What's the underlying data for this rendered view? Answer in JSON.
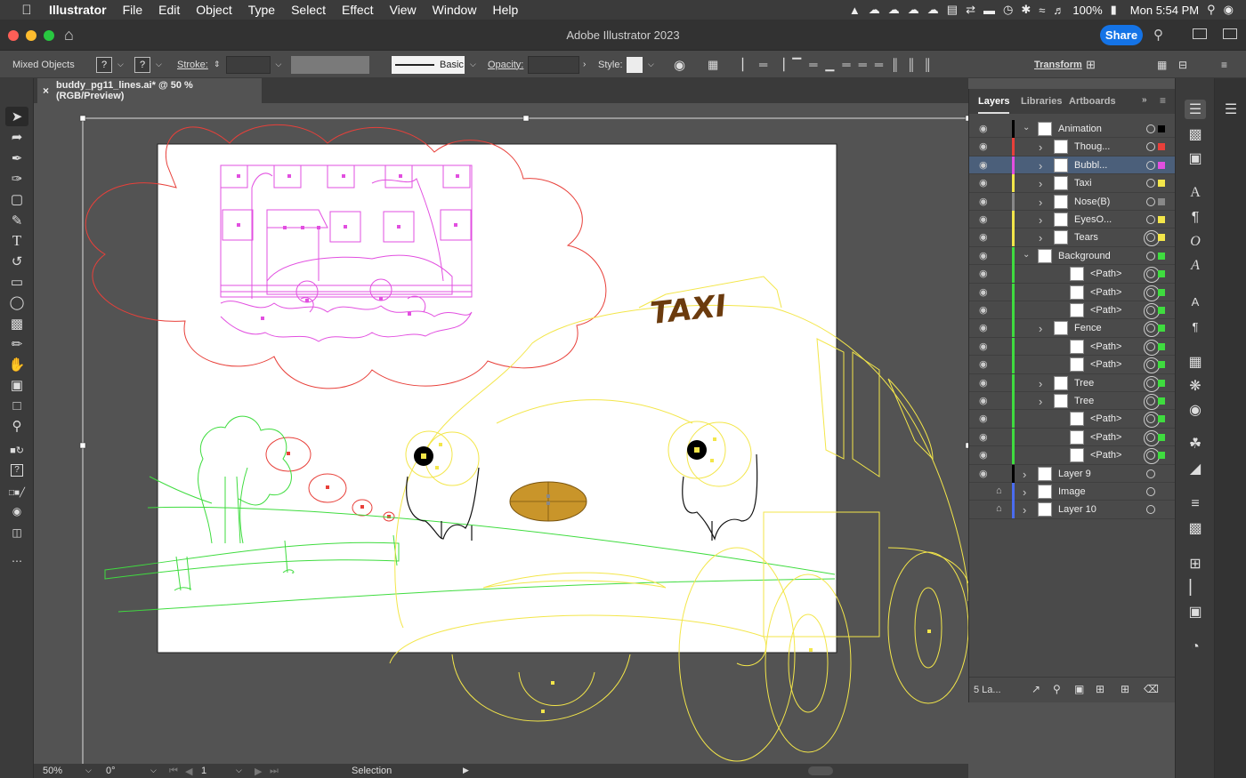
{
  "menubar": {
    "app_name": "Illustrator",
    "items": [
      "File",
      "Edit",
      "Object",
      "Type",
      "Select",
      "Effect",
      "View",
      "Window",
      "Help"
    ],
    "battery": "100%",
    "clock": "Mon 5:54 PM"
  },
  "titlebar": {
    "title": "Adobe Illustrator 2023",
    "share_label": "Share"
  },
  "controlbar": {
    "selection_type": "Mixed Objects",
    "fill_label": "?",
    "stroke_swatch_label": "?",
    "stroke_label": "Stroke:",
    "brush_label": "Basic",
    "opacity_label": "Opacity:",
    "style_label": "Style:",
    "transform_label": "Transform"
  },
  "document_tab": {
    "filename": "buddy_pg11_lines.ai* @ 50 % (RGB/Preview)"
  },
  "artwork": {
    "taxi_sign_text": "TAXI"
  },
  "statusbar": {
    "zoom": "50%",
    "rotation": "0°",
    "artboard_number": "1",
    "tool_name": "Selection"
  },
  "layers_panel": {
    "tabs": [
      "Layers",
      "Libraries",
      "Artboards"
    ],
    "active_tab": "Layers",
    "rows": [
      {
        "name": "Animation",
        "indent": 0,
        "expanded": true,
        "color": "#000000",
        "target_double": false,
        "locked": false
      },
      {
        "name": "Thoug...",
        "indent": 1,
        "expanded": false,
        "color": "#e8403a",
        "target_double": false,
        "locked": false
      },
      {
        "name": "Bubbl...",
        "indent": 1,
        "expanded": false,
        "color": "#e24fe0",
        "target_double": false,
        "locked": false,
        "selected": true
      },
      {
        "name": "Taxi",
        "indent": 1,
        "expanded": false,
        "color": "#f3e64a",
        "target_double": false,
        "locked": false
      },
      {
        "name": "Nose(B)",
        "indent": 1,
        "expanded": false,
        "color": "#888888",
        "target_double": false,
        "locked": false
      },
      {
        "name": "EyesO...",
        "indent": 1,
        "expanded": false,
        "color": "#f3e64a",
        "target_double": false,
        "locked": false
      },
      {
        "name": "Tears",
        "indent": 1,
        "expanded": false,
        "color": "#f3e64a",
        "target_double": true,
        "locked": false
      },
      {
        "name": "Background",
        "indent": 0,
        "expanded": true,
        "color": "#3fdc3f",
        "target_double": false,
        "locked": false
      },
      {
        "name": "<Path>",
        "indent": 2,
        "expanded": null,
        "color": "#3fdc3f",
        "target_double": true,
        "locked": false
      },
      {
        "name": "<Path>",
        "indent": 2,
        "expanded": null,
        "color": "#3fdc3f",
        "target_double": true,
        "locked": false
      },
      {
        "name": "<Path>",
        "indent": 2,
        "expanded": null,
        "color": "#3fdc3f",
        "target_double": true,
        "locked": false
      },
      {
        "name": "Fence",
        "indent": 1,
        "expanded": false,
        "color": "#3fdc3f",
        "target_double": true,
        "locked": false
      },
      {
        "name": "<Path>",
        "indent": 2,
        "expanded": null,
        "color": "#3fdc3f",
        "target_double": true,
        "locked": false
      },
      {
        "name": "<Path>",
        "indent": 2,
        "expanded": null,
        "color": "#3fdc3f",
        "target_double": true,
        "locked": false
      },
      {
        "name": "Tree",
        "indent": 1,
        "expanded": false,
        "color": "#3fdc3f",
        "target_double": true,
        "locked": false
      },
      {
        "name": "Tree",
        "indent": 1,
        "expanded": false,
        "color": "#3fdc3f",
        "target_double": true,
        "locked": false
      },
      {
        "name": "<Path>",
        "indent": 2,
        "expanded": null,
        "color": "#3fdc3f",
        "target_double": true,
        "locked": false
      },
      {
        "name": "<Path>",
        "indent": 2,
        "expanded": null,
        "color": "#3fdc3f",
        "target_double": true,
        "locked": false
      },
      {
        "name": "<Path>",
        "indent": 2,
        "expanded": null,
        "color": "#3fdc3f",
        "target_double": true,
        "locked": false
      },
      {
        "name": "Layer 9",
        "indent": 0,
        "expanded": false,
        "color": "#000000",
        "target_double": false,
        "locked": false
      },
      {
        "name": "Image",
        "indent": 0,
        "expanded": false,
        "color": "#4a6cf0",
        "target_double": false,
        "locked": true
      },
      {
        "name": "Layer 10",
        "indent": 0,
        "expanded": false,
        "color": "#4a6cf0",
        "target_double": false,
        "locked": true
      }
    ],
    "footer_label": "5 La..."
  }
}
